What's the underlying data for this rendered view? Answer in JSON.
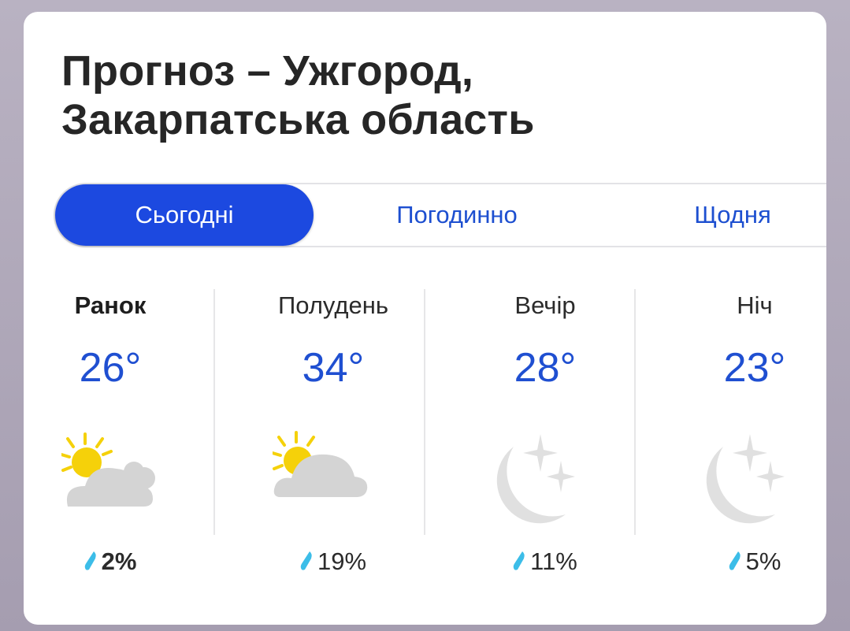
{
  "header": {
    "title_line1": "Прогноз – Ужгород,",
    "title_line2": "Закарпатська область"
  },
  "tabs": [
    {
      "label": "Сьогодні",
      "active": true
    },
    {
      "label": "Погодинно",
      "active": false
    },
    {
      "label": "Щодня",
      "active": false
    }
  ],
  "periods": [
    {
      "label": "Ранок",
      "temp": "26°",
      "precip": "2%",
      "icon": "partly-cloudy-sun-icon"
    },
    {
      "label": "Полудень",
      "temp": "34°",
      "precip": "19%",
      "icon": "partly-cloudy-sun-icon"
    },
    {
      "label": "Вечір",
      "temp": "28°",
      "precip": "11%",
      "icon": "moon-stars-icon"
    },
    {
      "label": "Ніч",
      "temp": "23°",
      "precip": "5%",
      "icon": "moon-stars-icon"
    }
  ],
  "colors": {
    "accent": "#1c49e0",
    "temp": "#1f4fd1",
    "drop": "#3cbde8",
    "sun": "#f5d10a",
    "cloud": "#d4d4d4"
  }
}
